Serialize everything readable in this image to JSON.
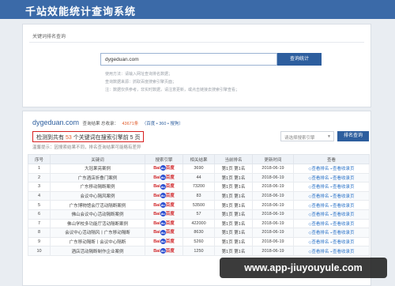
{
  "header": {
    "title": "千站效能统计查询系统"
  },
  "query_panel": {
    "breadcrumb": "关键词排名查询",
    "search_value": "dygeduan.com",
    "search_button": "查询统计",
    "help": [
      "使用方法：请输入网址查询排名数据；",
      "查询数据来源：抓取百度搜索引擎页面；",
      "注：数据仅供参考，非实时数据，请注意更新，或点击链接去搜索引擎查看；"
    ]
  },
  "result": {
    "domain": "dygeduan.com",
    "meta_prefix": "查询结果 总收录：",
    "total": "43671条",
    "links_text": "（百度 • 360 • 搜狗）",
    "summary_prefix": "检测到共有 ",
    "summary_count": "53",
    "summary_suffix": " 个关键词在搜索引擎前 5 页",
    "tip": "温馨提示：因搜索结果不同，排名查询结果可能略有差异",
    "engine_placeholder": "请选择搜索引擎",
    "rank_button": "排名查询",
    "columns": [
      "序号",
      "关键词",
      "搜索引擎",
      "相关结果",
      "当前排名",
      "更新时间",
      "查看"
    ],
    "engine_name": {
      "bai": "Bai",
      "paw": "du",
      "cn": "百度"
    },
    "view_label": "查看排名",
    "live_label": "查看收录页",
    "rows": [
      {
        "n": "1",
        "keyword": "大冠果亮案例",
        "results": "3690",
        "rank": "第1页 第1名",
        "date": "2018-06-19"
      },
      {
        "n": "2",
        "keyword": "广东酒店折叠门案例",
        "results": "44",
        "rank": "第1页 第1名",
        "date": "2018-06-19"
      },
      {
        "n": "3",
        "keyword": "广东移动隔断案例",
        "results": "73200",
        "rank": "第1页 第1名",
        "date": "2018-06-19"
      },
      {
        "n": "4",
        "keyword": "会议中心隔风案例",
        "results": "83",
        "rank": "第1页 第1名",
        "date": "2018-06-19"
      },
      {
        "n": "5",
        "keyword": "广东博物馆会厅活动隔断案例",
        "results": "53500",
        "rank": "第1页 第1名",
        "date": "2018-06-19"
      },
      {
        "n": "6",
        "keyword": "佛山会议中心活动隔断案例",
        "results": "57",
        "rank": "第1页 第1名",
        "date": "2018-06-19"
      },
      {
        "n": "7",
        "keyword": "佛山学校多功能厅活动隔断案例",
        "results": "422000",
        "rank": "第1页 第1名",
        "date": "2018-06-19"
      },
      {
        "n": "8",
        "keyword": "会议中心活动隔风丨广东移动隔断",
        "results": "8630",
        "rank": "第1页 第1名",
        "date": "2018-06-19"
      },
      {
        "n": "9",
        "keyword": "广东移动隔断丨会议中心隔断",
        "results": "5260",
        "rank": "第1页 第1名",
        "date": "2018-06-19"
      },
      {
        "n": "10",
        "keyword": "酒店活动隔断制作企业案例",
        "results": "1250",
        "rank": "第1页 第1名",
        "date": "2018-06-19"
      }
    ]
  },
  "watermark": "www.app-jiuyouyule.com"
}
